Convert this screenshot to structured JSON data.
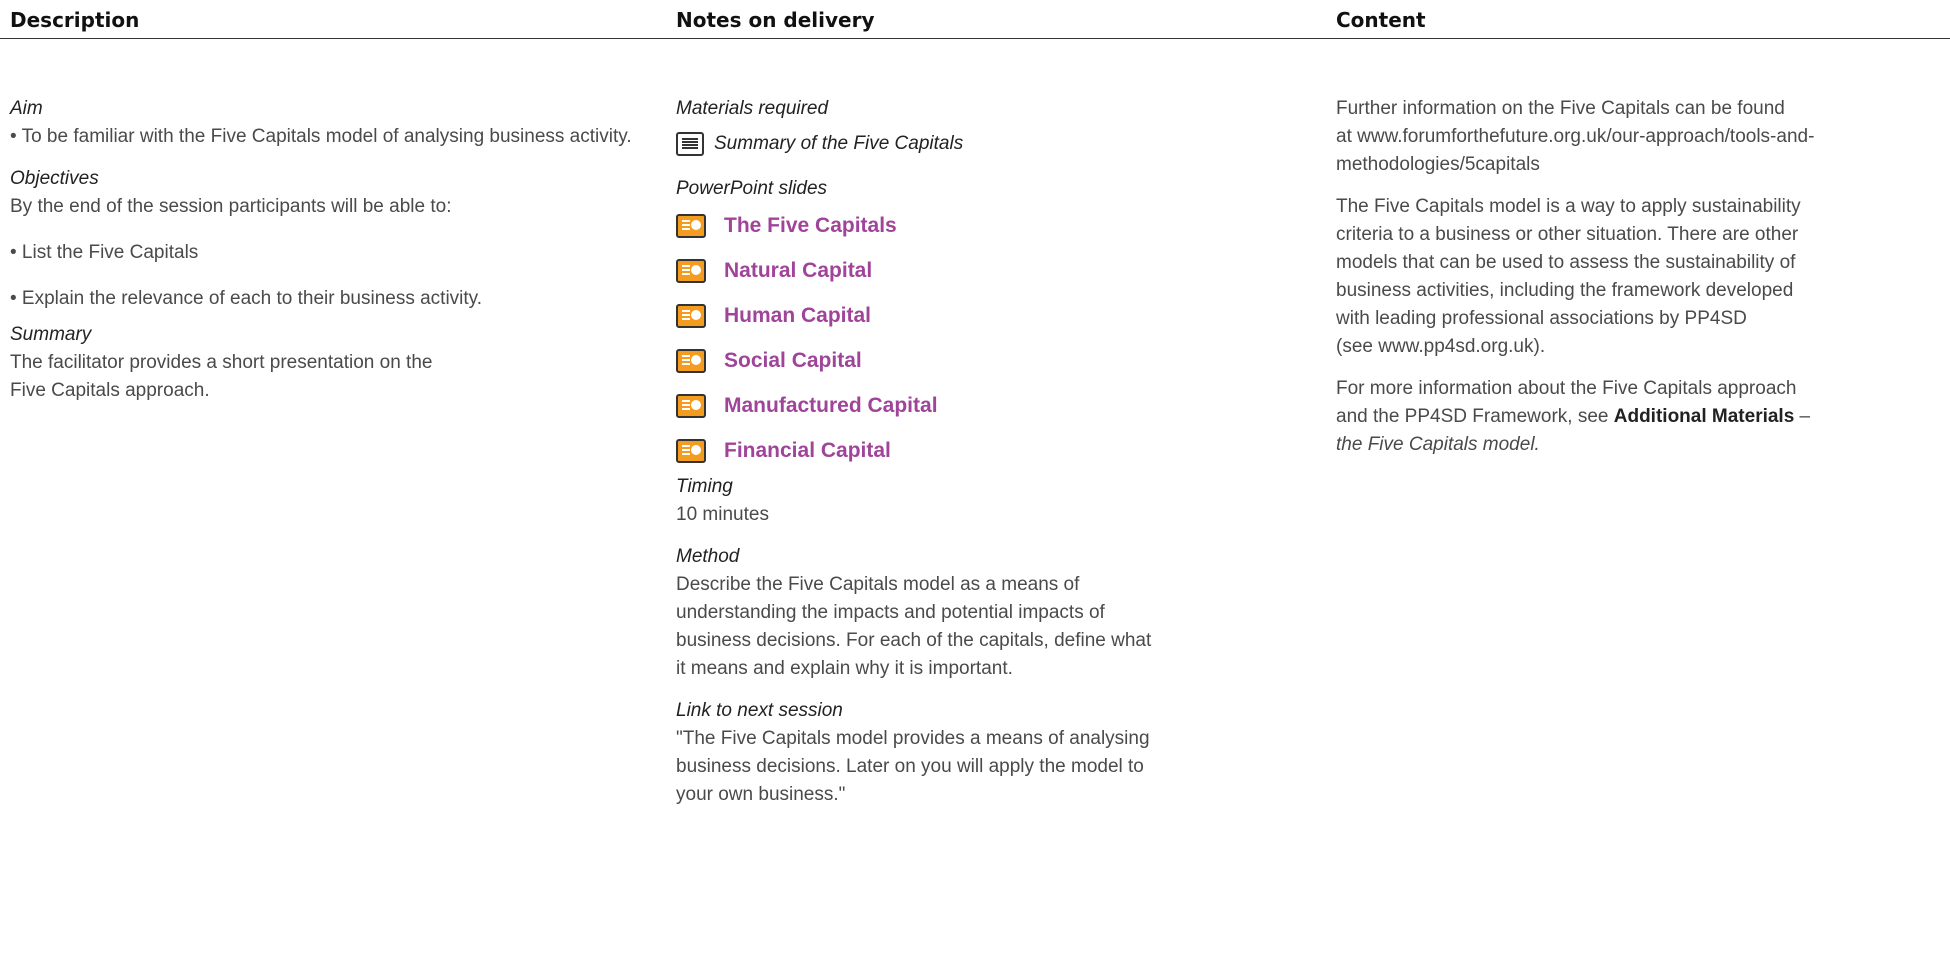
{
  "headers": {
    "description": "Description",
    "notes": "Notes on delivery",
    "content": "Content"
  },
  "description": {
    "aim_label": "Aim",
    "aim_bullet": "• To be familiar with the Five Capitals model of analysing business activity.",
    "objectives_label": "Objectives",
    "objectives_intro": "By the end of the session participants will be able to:",
    "objectives_bullets": [
      "• List the Five Capitals",
      "• Explain the relevance of each to their business activity."
    ],
    "summary_label": "Summary",
    "summary_line1": "The facilitator provides a short presentation on the",
    "summary_line2": "Five Capitals approach."
  },
  "notes": {
    "materials_label": "Materials required",
    "material_item": "Summary of the Five Capitals",
    "material_icon": "document-icon",
    "slides_label": "PowerPoint slides",
    "slide_icon": "powerpoint-icon",
    "slides": [
      "The Five Capitals",
      "Natural Capital",
      "Human Capital",
      "Social Capital",
      "Manufactured Capital",
      "Financial Capital"
    ],
    "timing_label": "Timing",
    "timing_value": "10 minutes",
    "method_label": "Method",
    "method_lines": [
      "Describe the Five Capitals model as a means of",
      "understanding the impacts and potential impacts of",
      "business decisions. For each of the capitals, define what",
      "it means and explain why it is important."
    ],
    "link_label": "Link to next session",
    "link_lines": [
      "\"The Five Capitals model provides a means of analysing",
      "business decisions. Later on you will apply the model to",
      "your own business.\""
    ]
  },
  "content": {
    "p1_lines": [
      "Further information on the Five Capitals can be found",
      "at www.forumforthefuture.org.uk/our-approach/tools-and-",
      "methodologies/5capitals"
    ],
    "p2_lines": [
      "The Five Capitals model is a way to apply sustainability",
      "criteria to a business or other situation. There are other",
      "models that can be used to assess the sustainability of",
      "business activities, including the framework developed",
      "with leading professional associations by PP4SD",
      "(see www.pp4sd.org.uk)."
    ],
    "p3_line1": "For more information about the Five Capitals approach",
    "p3_line2_pre": "and the PP4SD Framework, see ",
    "p3_bold": "Additional Materials",
    "p3_dash": " –",
    "p3_italic": "the Five Capitals model."
  },
  "colors": {
    "slide_link": "#a0449a",
    "ppt_icon": "#f39c1f",
    "body_text": "#4a4a4a"
  }
}
